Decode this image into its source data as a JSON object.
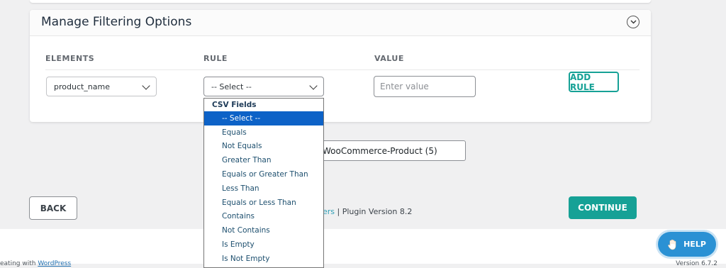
{
  "panel": {
    "title": "Manage Filtering Options",
    "columns": [
      "ELEMENTS",
      "RULE",
      "VALUE"
    ]
  },
  "row": {
    "element_value": "product_name",
    "rule_value": "-- Select --",
    "value_placeholder": "Enter value",
    "add_rule_label": "ADD RULE"
  },
  "dropdown": {
    "group_label": "CSV Fields",
    "options": [
      "-- Select --",
      "Equals",
      "Not Equals",
      "Greater Than",
      "Equals or Greater Than",
      "Less Than",
      "Equals or Less Than",
      "Contains",
      "Not Contains",
      "Is Empty",
      "Is Not Empty"
    ],
    "selected": "-- Select --"
  },
  "module_box": {
    "text": "WooCommerce-Product (5)"
  },
  "buttons": {
    "back": "BACK",
    "continue": "CONTINUE",
    "help": "HELP"
  },
  "footer": {
    "link_fragment": "ers",
    "plugin_version": " | Plugin Version 8.2"
  },
  "wp_footer": {
    "left_prefix": "eating with ",
    "left_link": "WordPress",
    "right": "Version 6.7.2"
  },
  "colors": {
    "accent": "#16a196",
    "help": "#2a91d4",
    "selected_option": "#0d62c7"
  }
}
